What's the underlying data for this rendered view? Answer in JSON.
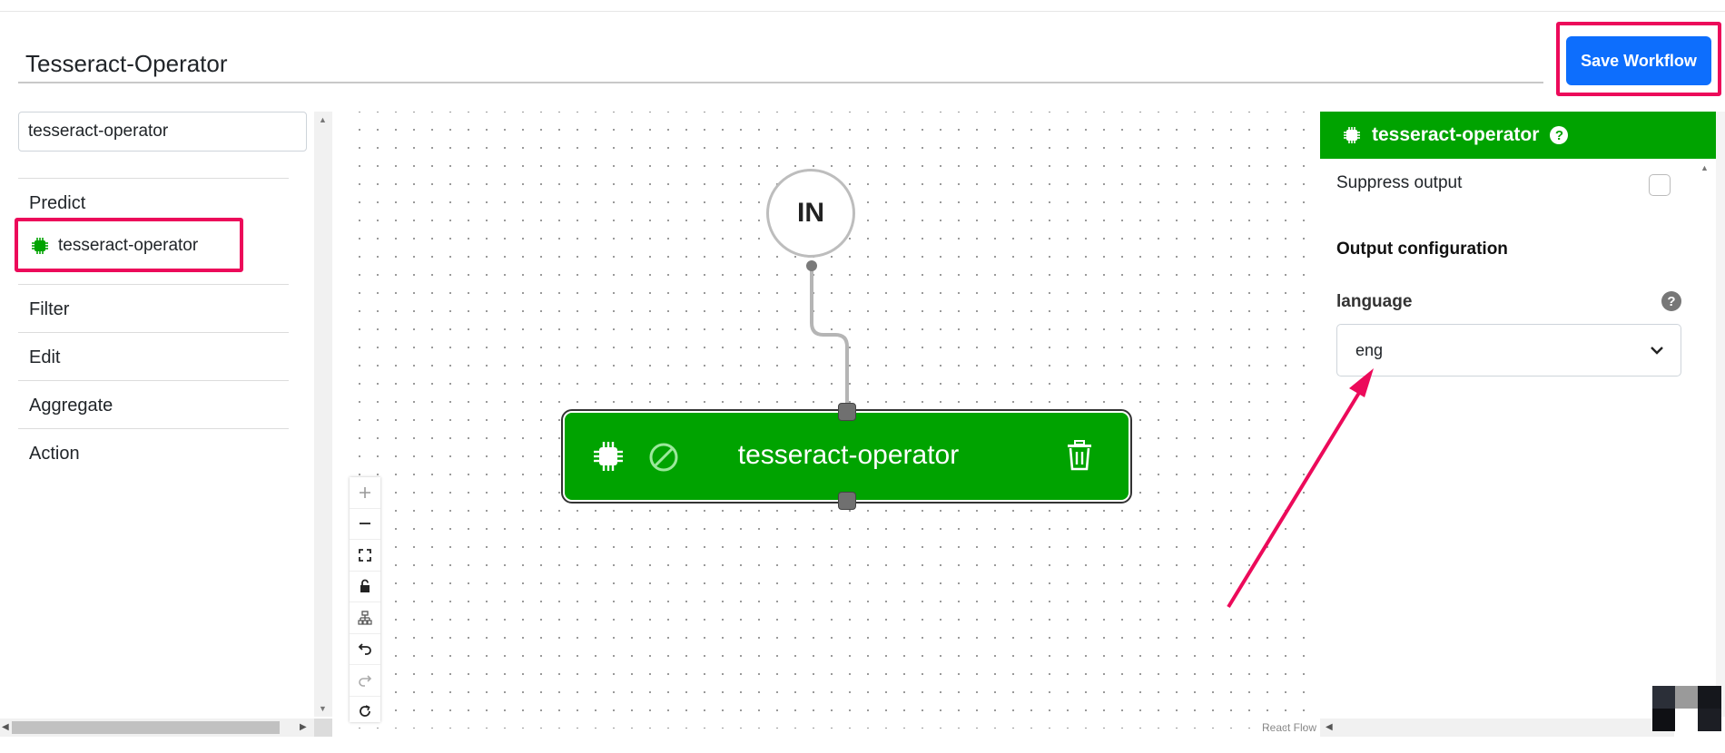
{
  "header": {
    "workflow_title": "Tesseract-Operator",
    "save_label": "Save Workflow"
  },
  "sidebar": {
    "search_value": "tesseract-operator",
    "groups": [
      {
        "label": "Predict",
        "items": [
          {
            "label": "tesseract-operator",
            "icon": "chip-icon",
            "color": "#00a300"
          }
        ]
      },
      {
        "label": "Filter"
      },
      {
        "label": "Edit"
      },
      {
        "label": "Aggregate"
      },
      {
        "label": "Action"
      }
    ]
  },
  "canvas": {
    "input_node_label": "IN",
    "operator_node_label": "tesseract-operator",
    "node_color": "#00a300",
    "attribution": "React Flow",
    "controls": [
      "zoom-in",
      "zoom-out",
      "fit-view",
      "lock",
      "auto-layout",
      "undo",
      "redo",
      "reset"
    ]
  },
  "panel": {
    "title": "tesseract-operator",
    "help_glyph": "?",
    "suppress_output_label": "Suppress output",
    "suppress_output_checked": false,
    "output_config_title": "Output configuration",
    "language_label": "language",
    "language_help": "?",
    "language_value": "eng"
  },
  "colors": {
    "accent": "#0d6efd",
    "highlight": "#ec0a5a",
    "node_green": "#00a300"
  }
}
